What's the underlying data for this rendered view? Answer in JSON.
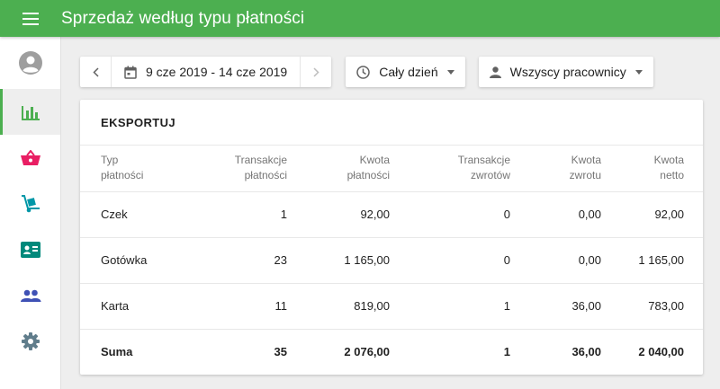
{
  "header": {
    "title": "Sprzedaż według typu płatności"
  },
  "sidebar": {
    "items": [
      {
        "icon": "account-icon"
      },
      {
        "icon": "bar-chart-icon",
        "active": true
      },
      {
        "icon": "basket-icon",
        "color": "#e91e63"
      },
      {
        "icon": "hand-truck-icon",
        "color": "#0097a7"
      },
      {
        "icon": "contact-card-icon",
        "color": "#00897b"
      },
      {
        "icon": "people-icon",
        "color": "#3f51b5"
      },
      {
        "icon": "gear-icon",
        "color": "#607d8b"
      }
    ]
  },
  "filters": {
    "date_range": "9 cze 2019 - 14 cze 2019",
    "time_range": "Cały dzień",
    "staff": "Wszyscy pracownicy"
  },
  "card": {
    "export_label": "EKSPORTUJ"
  },
  "table": {
    "headers": [
      [
        "Typ",
        "płatności"
      ],
      [
        "Transakcje",
        "płatności"
      ],
      [
        "Kwota",
        "płatności"
      ],
      [
        "Transakcje",
        "zwrotów"
      ],
      [
        "Kwota",
        "zwrotu"
      ],
      [
        "Kwota",
        "netto"
      ]
    ],
    "rows": [
      [
        "Czek",
        "1",
        "92,00",
        "0",
        "0,00",
        "92,00"
      ],
      [
        "Gotówka",
        "23",
        "1 165,00",
        "0",
        "0,00",
        "1 165,00"
      ],
      [
        "Karta",
        "11",
        "819,00",
        "1",
        "36,00",
        "783,00"
      ]
    ],
    "total": [
      "Suma",
      "35",
      "2 076,00",
      "1",
      "36,00",
      "2 040,00"
    ]
  },
  "colors": {
    "accent": "#4caf50"
  }
}
